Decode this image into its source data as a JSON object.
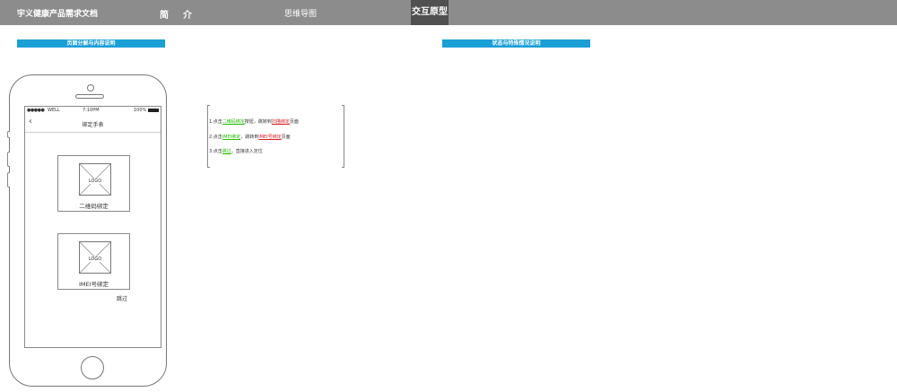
{
  "header": {
    "brand": "宇义健康产品需求文档",
    "nav_intro_1": "简",
    "nav_intro_2": "介",
    "nav_mindmap": "思维导图",
    "nav_prototype": "交互原型"
  },
  "sections": {
    "left_title": "页面分解与内容说明",
    "right_title": "状态与特殊情况说明"
  },
  "phone": {
    "status": {
      "signal": "●●●●●",
      "carrier": "WELL",
      "time": "7:10PM",
      "battery": "100%"
    },
    "back_icon": "‹",
    "title": "绑定手表",
    "cards": [
      {
        "logo": "LOGO",
        "label": "二维码绑定"
      },
      {
        "logo": "LOGO",
        "label": "IMEI号绑定"
      }
    ],
    "skip": "跳过"
  },
  "annotation": {
    "line1": {
      "prefix": "1.点击",
      "link": "二维码绑定",
      "mid": "按钮，跳转到",
      "target": "扫描绑定",
      "suffix": "页面"
    },
    "line2": {
      "prefix": "2.点击",
      "link": "IMEI绑定",
      "mid": "，跳转到",
      "target": "IMEI号绑定",
      "suffix": "页面"
    },
    "line3": {
      "prefix": "3.点击",
      "link": "跳过",
      "mid": "，直接进入定位"
    }
  },
  "colors": {
    "topbar": "#8c8c8c",
    "active_tab": "#505050",
    "section_bar": "#1a9fd6",
    "link_green": "#22c000",
    "link_red": "#e02020"
  }
}
